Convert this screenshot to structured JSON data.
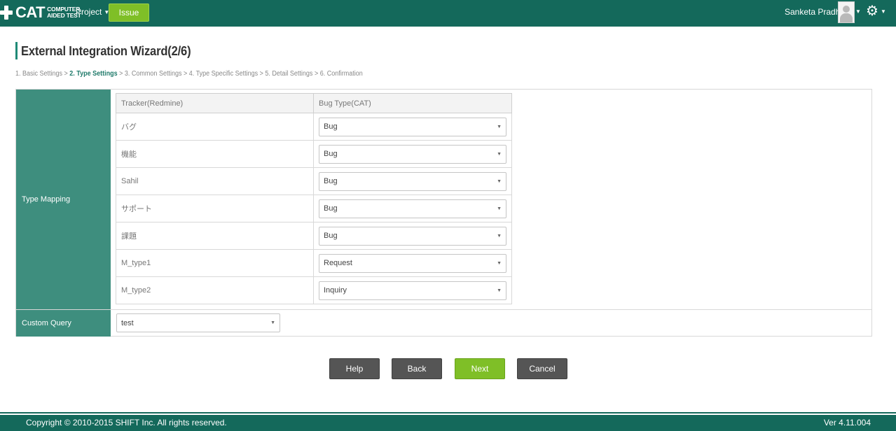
{
  "header": {
    "logo_text": "CAT",
    "logo_sub_line1": "COMPUTER",
    "logo_sub_line2": "AIDED TEST",
    "project_label": "Project",
    "issue_label": "Issue",
    "user_name": "Sanketa Pradhan"
  },
  "page": {
    "title": "External Integration Wizard(2/6)",
    "steps": [
      "1. Basic Settings",
      "2. Type Settings",
      "3. Common Settings",
      "4. Type Specific Settings",
      "5. Detail Settings",
      "6. Confirmation"
    ],
    "separator": ">"
  },
  "form": {
    "type_mapping_label": "Type Mapping",
    "custom_query_label": "Custom Query",
    "columns": [
      "Tracker(Redmine)",
      "Bug Type(CAT)"
    ],
    "rows": [
      {
        "tracker": "バグ",
        "bug_type": "Bug"
      },
      {
        "tracker": "機能",
        "bug_type": "Bug"
      },
      {
        "tracker": "Sahil",
        "bug_type": "Bug"
      },
      {
        "tracker": "サポート",
        "bug_type": "Bug"
      },
      {
        "tracker": "課題",
        "bug_type": "Bug"
      },
      {
        "tracker": "M_type1",
        "bug_type": "Request"
      },
      {
        "tracker": "M_type2",
        "bug_type": "Inquiry"
      }
    ],
    "custom_query_value": "test"
  },
  "buttons": {
    "help": "Help",
    "back": "Back",
    "next": "Next",
    "cancel": "Cancel"
  },
  "footer": {
    "copyright": "Copyright © 2010-2015 SHIFT Inc. All rights reserved.",
    "version": "Ver 4.11.004"
  },
  "colors": {
    "header_bg": "#14695b",
    "label_bg": "#3e8e7e",
    "accent_green": "#7fbf27",
    "button_dark": "#555555"
  },
  "icons": [
    "plus-cross-logo-icon",
    "caret-down-icon",
    "user-avatar-icon",
    "gear-icon",
    "select-arrow-icon"
  ]
}
